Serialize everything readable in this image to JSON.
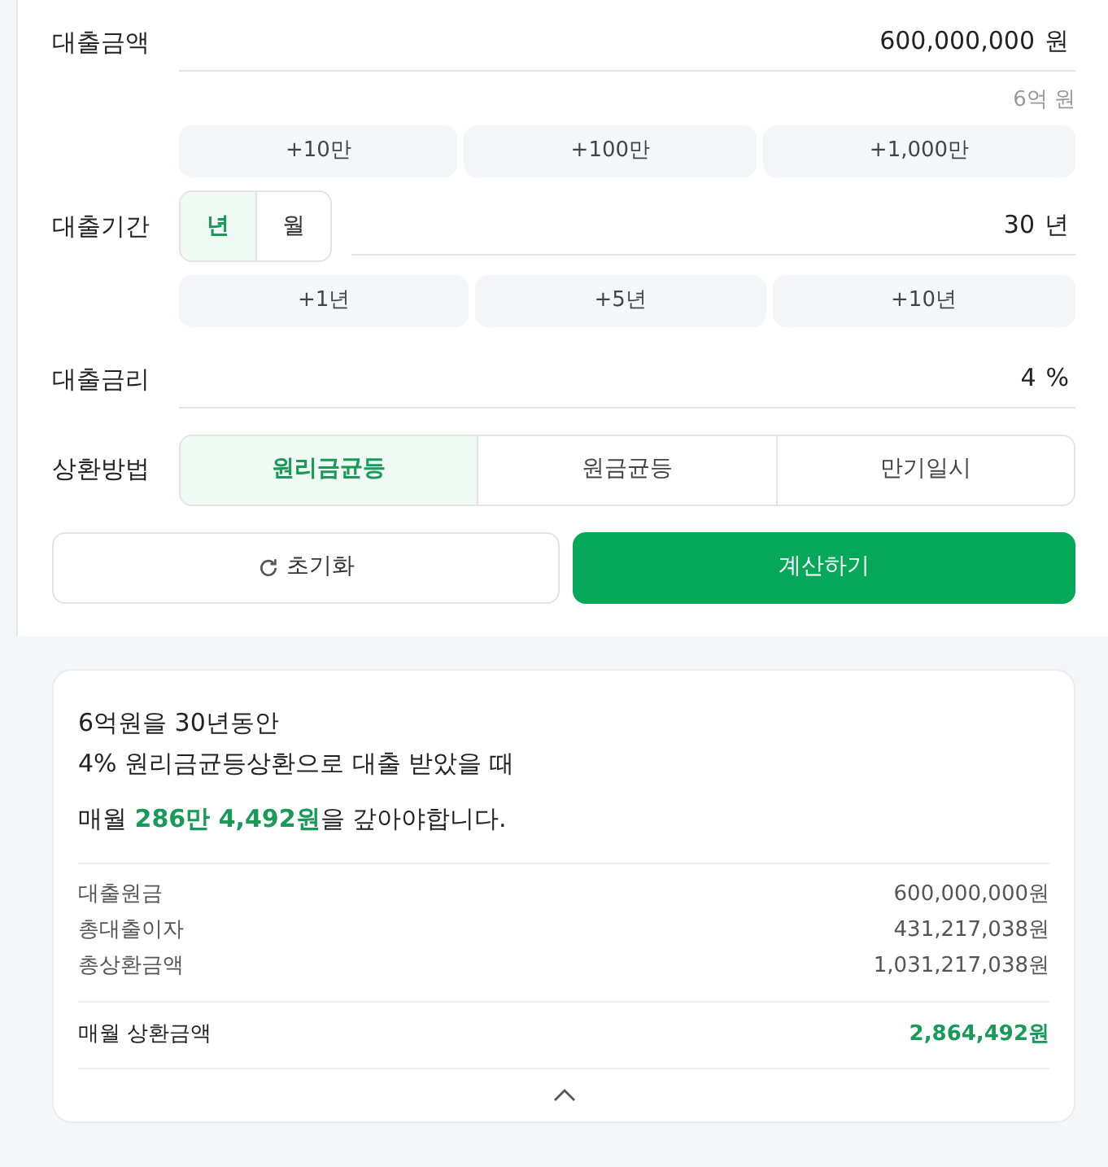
{
  "amount": {
    "label": "대출금액",
    "value": "600,000,000",
    "unit": "원",
    "hint": "6억 원",
    "increments": [
      "+10만",
      "+100만",
      "+1,000만"
    ]
  },
  "period": {
    "label": "대출기간",
    "unit_toggle": [
      {
        "label": "년",
        "selected": true
      },
      {
        "label": "월",
        "selected": false
      }
    ],
    "value": "30",
    "unit": "년",
    "increments": [
      "+1년",
      "+5년",
      "+10년"
    ]
  },
  "rate": {
    "label": "대출금리",
    "value": "4",
    "unit": "%"
  },
  "method": {
    "label": "상환방법",
    "options": [
      {
        "label": "원리금균등",
        "selected": true
      },
      {
        "label": "원금균등",
        "selected": false
      },
      {
        "label": "만기일시",
        "selected": false
      }
    ]
  },
  "reset_button": {
    "label": "초기화"
  },
  "calculate_button": {
    "label": "계산하기"
  },
  "result": {
    "summary_lines": [
      "6억원을 30년동안",
      "4% 원리금균등상환으로 대출 받았을 때"
    ],
    "monthly_sentence": "매월 **286만 4,492원**을 갚아야합니다.",
    "details": [
      {
        "label": "대출원금",
        "value": "600,000,000원"
      },
      {
        "label": "총대출이자",
        "value": "431,217,038원"
      },
      {
        "label": "총상환금액",
        "value": "1,031,217,038원"
      }
    ],
    "monthly_row": {
      "label": "매월 상환금액",
      "value": "2,864,492원"
    }
  }
}
